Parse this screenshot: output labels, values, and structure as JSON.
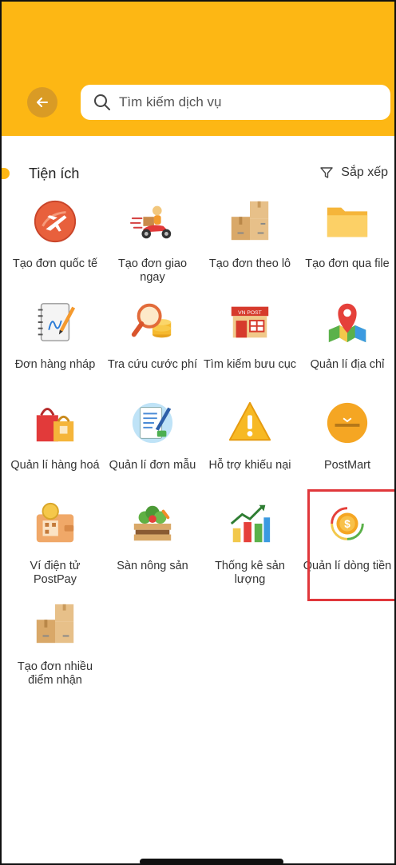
{
  "header": {
    "search_placeholder": "Tìm kiếm dịch vụ"
  },
  "section": {
    "title": "Tiện ích",
    "sort_label": "Sắp xếp"
  },
  "colors": {
    "brand": "#fdb714",
    "highlight": "#e0373b"
  },
  "tiles": [
    {
      "label": "Tạo đơn quốc tế",
      "icon": "international-order-icon"
    },
    {
      "label": "Tạo đơn giao ngay",
      "icon": "express-delivery-icon"
    },
    {
      "label": "Tạo đơn theo lô",
      "icon": "batch-boxes-icon"
    },
    {
      "label": "Tạo đơn qua file",
      "icon": "folder-icon"
    },
    {
      "label": "Đơn hàng nháp",
      "icon": "draft-note-icon"
    },
    {
      "label": "Tra cứu cước phí",
      "icon": "fee-lookup-icon"
    },
    {
      "label": "Tìm kiếm bưu cục",
      "icon": "post-office-icon"
    },
    {
      "label": "Quản lí địa chỉ",
      "icon": "address-pin-icon"
    },
    {
      "label": "Quản lí hàng hoá",
      "icon": "shopping-bags-icon"
    },
    {
      "label": "Quản lí đơn mẫu",
      "icon": "template-form-icon"
    },
    {
      "label": "Hỗ trợ khiếu nại",
      "icon": "warning-icon"
    },
    {
      "label": "PostMart",
      "icon": "postmart-logo-icon"
    },
    {
      "label": "Ví điện tử PostPay",
      "icon": "wallet-icon"
    },
    {
      "label": "Sàn nông sản",
      "icon": "produce-crate-icon"
    },
    {
      "label": "Thống kê sản lượng",
      "icon": "bar-chart-icon"
    },
    {
      "label": "Quản lí dòng tiền",
      "icon": "cash-flow-icon"
    },
    {
      "label": "Tạo đơn nhiều điểm nhận",
      "icon": "multi-point-boxes-icon"
    }
  ]
}
